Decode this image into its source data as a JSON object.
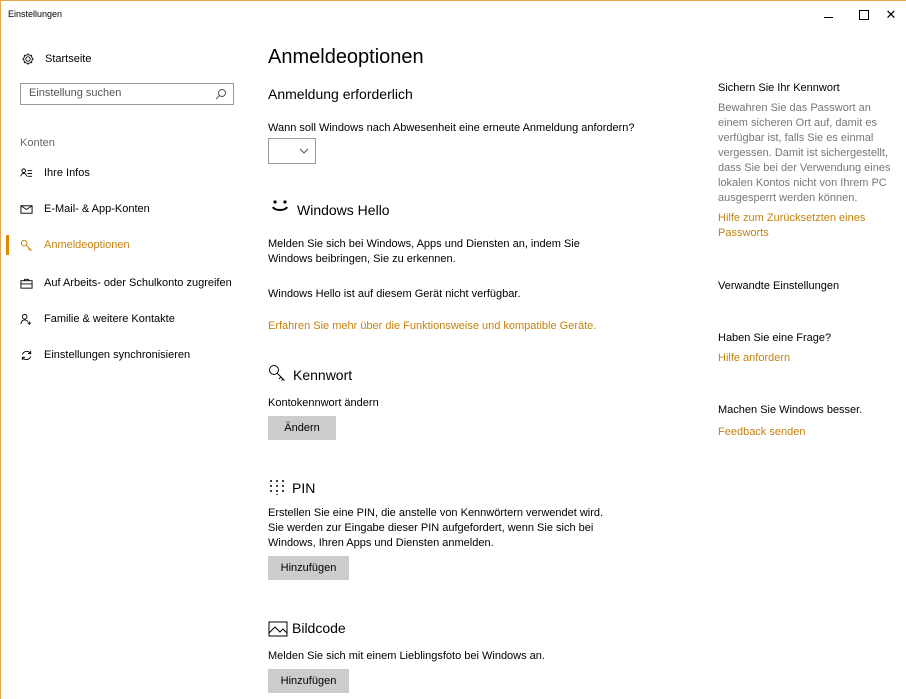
{
  "window": {
    "title": "Einstellungen",
    "minimize_symbol": "–",
    "maximize_symbol": "□",
    "close_symbol": "✕"
  },
  "sidebar": {
    "home_label": "Startseite",
    "search_placeholder": "Einstellung suchen",
    "section_title": "Konten",
    "items": [
      {
        "label": "Ihre Infos",
        "icon": "person-lines-icon"
      },
      {
        "label": "E-Mail- & App-Konten",
        "icon": "mail-icon"
      },
      {
        "label": "Anmeldeoptionen",
        "icon": "key-icon",
        "active": true
      },
      {
        "label": "Auf Arbeits- oder Schulkonto zugreifen",
        "icon": "briefcase-icon"
      },
      {
        "label": "Familie & weitere Kontakte",
        "icon": "person-add-icon"
      },
      {
        "label": "Einstellungen synchronisieren",
        "icon": "sync-icon"
      }
    ]
  },
  "main": {
    "page_title": "Anmeldeoptionen",
    "signin_required": {
      "heading": "Anmeldung erforderlich",
      "question": "Wann soll Windows nach Abwesenheit eine erneute Anmeldung anfordern?",
      "dropdown_value": ""
    },
    "hello": {
      "heading": "Windows Hello",
      "description_line1": "Melden Sie sich bei Windows, Apps und Diensten an, indem Sie",
      "description_line2": "Windows beibringen, Sie zu erkennen.",
      "unavailable": "Windows Hello ist auf diesem Gerät nicht verfügbar.",
      "learn_more": "Erfahren Sie mehr über die Funktionsweise und kompatible Geräte."
    },
    "password": {
      "heading": "Kennwort",
      "label": "Kontokennwort ändern",
      "button": "Ändern"
    },
    "pin": {
      "heading": "PIN",
      "line1": "Erstellen Sie eine PIN, die anstelle von Kennwörtern verwendet wird.",
      "line2": "Sie werden zur Eingabe dieser PIN aufgefordert, wenn Sie sich bei",
      "line3": "Windows, Ihren Apps und Diensten anmelden.",
      "button": "Hinzufügen"
    },
    "picture": {
      "heading": "Bildcode",
      "description": "Melden Sie sich mit einem Lieblingsfoto bei Windows an.",
      "button": "Hinzufügen"
    }
  },
  "right": {
    "secure_title": "Sichern Sie Ihr Kennwort",
    "secure_lines": [
      "Bewahren Sie das Passwort an",
      "einem sicheren Ort auf, damit es",
      "verfügbar ist, falls Sie es einmal",
      "vergessen. Damit ist sichergestellt,",
      "dass Sie bei der Verwendung eines",
      "lokalen Kontos nicht von Ihrem PC",
      "ausgesperrt werden können."
    ],
    "reset_link_line1": "Hilfe zum Zurücksetzten eines",
    "reset_link_line2": "Passworts",
    "related_title": "Verwandte Einstellungen",
    "question_title": "Haben Sie eine Frage?",
    "help_link": "Hilfe anfordern",
    "better_title": "Machen Sie Windows besser.",
    "feedback_link": "Feedback senden"
  },
  "colors": {
    "accent": "#c4820f",
    "active_bar": "#e08a00",
    "button_bg": "#cccccc",
    "secondary_text": "#777777"
  }
}
